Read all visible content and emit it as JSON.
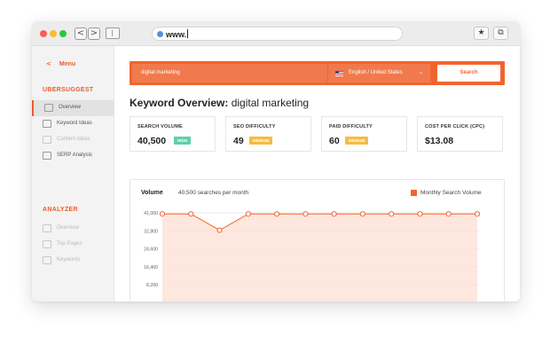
{
  "browser": {
    "url": "www.",
    "back_glyph": "<",
    "forward_glyph": ">",
    "bookmark_glyph": "★",
    "share_glyph": "⧉"
  },
  "sidebar": {
    "menu_chevron": "<",
    "menu_label": "Menu",
    "section1_title": "UBERSUGGEST",
    "section1_items": [
      {
        "label": "Overview",
        "active": true
      },
      {
        "label": "Keyword Ideas",
        "active": false
      },
      {
        "label": "Content Ideas",
        "active": false
      },
      {
        "label": "SERP Analysis",
        "active": false
      }
    ],
    "section2_title": "ANALYZER",
    "section2_items": [
      {
        "label": "Overview"
      },
      {
        "label": "Top Pages"
      },
      {
        "label": "Keywords"
      }
    ]
  },
  "search": {
    "query": "digital marketing",
    "locale": "English / United States",
    "caret": "⌄",
    "button_label": "Search"
  },
  "overview": {
    "title_bold": "Keyword Overview:",
    "title_keyword": "digital marketing"
  },
  "cards": [
    {
      "label": "SEARCH VOLUME",
      "value": "40,500",
      "badge": "HIGH",
      "badge_color": "#5fd0a8"
    },
    {
      "label": "SEO DIFFICULTY",
      "value": "49",
      "badge": "MEDIUM",
      "badge_color": "#f6bb42"
    },
    {
      "label": "PAID DIFFICULTY",
      "value": "60",
      "badge": "MEDIUM",
      "badge_color": "#f6bb42"
    },
    {
      "label": "COST PER CLICK (CPC)",
      "value": "$13.08",
      "badge": "",
      "badge_color": ""
    }
  ],
  "chart_header": {
    "volume_label": "Volume",
    "subtitle": "40,500 searches per month",
    "legend": "Monthly Search Volume"
  },
  "chart_data": {
    "type": "area",
    "yticks": [
      "41,000",
      "32,800",
      "24,600",
      "16,400",
      "8,200"
    ],
    "ylim": [
      0,
      41000
    ],
    "values": [
      40500,
      40500,
      33100,
      40500,
      40500,
      40500,
      40500,
      40500,
      40500,
      40500,
      40500,
      40500
    ],
    "series_color": "#f0652f",
    "fill_color": "#fde3d8",
    "grid": true
  }
}
